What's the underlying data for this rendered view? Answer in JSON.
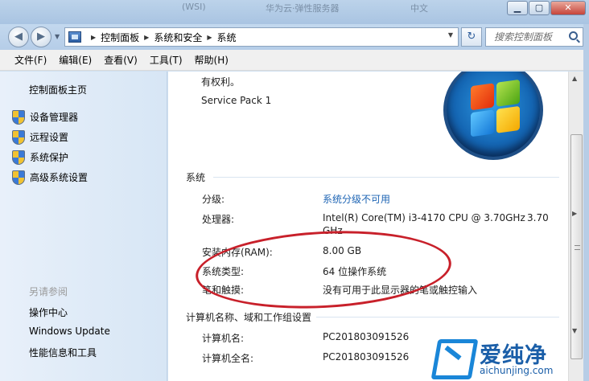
{
  "window": {
    "ghost_texts": [
      "(WSI)",
      "华为云·弹性服务器",
      "中文"
    ],
    "btn_min": "▁",
    "btn_max": "▢",
    "btn_close": "✕"
  },
  "nav": {
    "back": "◀",
    "forward": "▶",
    "breadcrumb": [
      "控制面板",
      "系统和安全",
      "系统"
    ],
    "refresh": "↻",
    "search_placeholder": "搜索控制面板"
  },
  "menu": [
    "文件(F)",
    "编辑(E)",
    "查看(V)",
    "工具(T)",
    "帮助(H)"
  ],
  "left": {
    "home": "控制面板主页",
    "tasks": [
      "设备管理器",
      "远程设置",
      "系统保护",
      "高级系统设置"
    ],
    "see_also_title": "另请参阅",
    "see_also": [
      "操作中心",
      "Windows Update",
      "性能信息和工具"
    ]
  },
  "content": {
    "copyright_tail": "有权利。",
    "service_pack": "Service Pack 1",
    "system_title": "系统",
    "rows": [
      {
        "label": "分级:",
        "value": "系统分级不可用"
      },
      {
        "label": "处理器:",
        "value": "Intel(R) Core(TM) i3-4170 CPU @ 3.70GHz",
        "value2": "3.70",
        "value3": "GHz"
      },
      {
        "label": "安装内存(RAM):",
        "value": "8.00 GB"
      },
      {
        "label": "系统类型:",
        "value": "64 位操作系统"
      },
      {
        "label": "笔和触摸:",
        "value": "没有可用于此显示器的笔或触控输入"
      }
    ],
    "computer_title": "计算机名称、域和工作组设置",
    "computer_rows": [
      {
        "label": "计算机名:",
        "value": "PC201803091526"
      },
      {
        "label": "计算机全名:",
        "value": "PC201803091526"
      }
    ]
  },
  "watermark": {
    "cn": "爱纯净",
    "url": "aichunjing.com"
  },
  "colors": {
    "link": "#1d64b4",
    "annotation_ellipse": "#c8202a"
  }
}
